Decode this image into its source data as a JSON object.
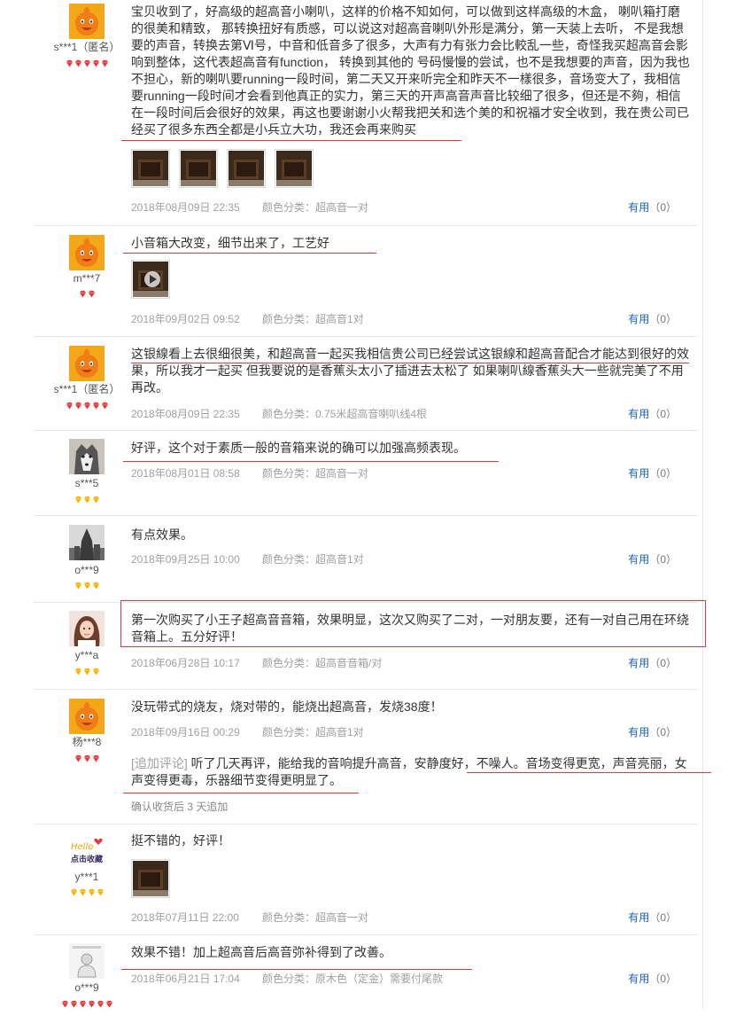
{
  "colors": {
    "accent_red": "#e4393c",
    "link_blue": "#1e62b4",
    "meta_gray": "#a0a0a0",
    "diamond_red": "#e4393c",
    "diamond_gold": "#f5b400"
  },
  "reviews": [
    {
      "username": "s***1（匿名）",
      "avatar": "mascot-avatar",
      "rank": "red-5",
      "content": "宝贝收到了，好高级的超高音小喇叭，这样的价格不知如何，可以做到这样高级的木盒， 喇叭箱打磨的很美和精致， 那转换扭好有质感，可以说这对超高音喇叭外形是满分，第一天装上去听， 不是我想要的声音，转换去第Ⅵ号，中音和低音多了很多，大声有力有张力会比較乱一些，奇怪我买超高音会影响到整体，这代表超高音有function， 转换到其他的 号码慢慢的尝试，也不是我想要的声音，因为我也不担心，新的喇叭要running一段时间，第二天又开来听完全和昨天不一樣很多，音场变大了，我相信要running一段时间才会看到他真正的实力，第三天的开声高音声音比较细了很多，但还是不夠，相信在一段时间后会很好的效果，再这也要谢谢小火帮我把关和选个美的和祝福才安全收到，我在贵公司已经买了很多东西全都是小兵立大功，我还会再来购买",
      "date": "2018年08月09日 22:35",
      "variant": "颜色分类：超高音一对",
      "helpful_label": "有用",
      "helpful_count": "（0）"
    },
    {
      "username": "m***7",
      "avatar": "mascot-avatar",
      "rank": "red-2",
      "content": "小音箱大改变，细节出来了，工艺好",
      "date": "2018年09月02日 09:52",
      "variant": "颜色分类：超高音1对",
      "helpful_label": "有用",
      "helpful_count": "（0）"
    },
    {
      "username": "s***1（匿名）",
      "avatar": "mascot-avatar",
      "rank": "red-5",
      "content": "这银線看上去很细很美，和超高音一起买我相信贵公司已经尝试这银線和超高音配合才能达到很好的效果，所以我才一起买 但我要说的是香蕉头太小了插进去太松了 如果喇叭線香蕉头大一些就完美了不用再改。",
      "date": "2018年08月09日 22:35",
      "variant": "颜色分类：0.75米超高音喇叭线4根",
      "helpful_label": "有用",
      "helpful_count": "（0）"
    },
    {
      "username": "s***5",
      "avatar": "husky-photo",
      "rank": "gold-3",
      "content": "好评，这个对于素质一般的音箱来说的确可以加强高频表现。",
      "date": "2018年08月01日 08:58",
      "variant": "颜色分类：超高音一对",
      "helpful_label": "有用",
      "helpful_count": "（0）"
    },
    {
      "username": "o***9",
      "avatar": "tower-photo",
      "rank": "gold-3",
      "content": "有点效果。",
      "date": "2018年09月25日 10:00",
      "variant": "颜色分类：超高音1对",
      "helpful_label": "有用",
      "helpful_count": "（0）"
    },
    {
      "username": "y***a",
      "avatar": "girl-photo",
      "rank": "gold-3",
      "content": "第一次购买了小王子超高音音箱，效果明显，这次又购买了二对，一对朋友要，还有一对自己用在环绕音箱上。五分好评！",
      "date": "2018年06月28日 10:17",
      "variant": "颜色分类：超高音音箱/对",
      "helpful_label": "有用",
      "helpful_count": "（0）"
    },
    {
      "username": "杨***8",
      "avatar": "mascot-avatar",
      "rank": "red-3",
      "content": "没玩带式的烧友，烧对带的，能烧出超高音，发烧38度！",
      "date": "2018年09月16日 00:29",
      "variant": "颜色分类：超高音1对",
      "helpful_label": "有用",
      "helpful_count": "（0）",
      "append_label": "[追加评论]",
      "append_content": "听了几天再评，能给我的音响提升高音，安静度好，不噪人。音场变得更宽，声音亮丽，女声变得更毒，乐器细节变得更明显了。",
      "append_time": "确认收货后 3 天追加"
    },
    {
      "username": "y***1",
      "avatar": "hello-text-avatar",
      "avatar_text_1": "Hello",
      "avatar_text_2": "点击收藏",
      "rank": "gold-4",
      "content": "挺不错的，好评！",
      "date": "2018年07月11日 22:00",
      "variant": "颜色分类：超高音一对",
      "helpful_label": "有用",
      "helpful_count": "（0）"
    },
    {
      "username": "o***9",
      "avatar": "sketch-photo",
      "rank": "red-6",
      "content": "效果不错！加上超高音后高音弥补得到了改善。",
      "date": "2018年06月21日 17:04",
      "variant": "颜色分类：原木色（定金）需要付尾款",
      "helpful_label": "有用",
      "helpful_count": "（0）"
    }
  ]
}
